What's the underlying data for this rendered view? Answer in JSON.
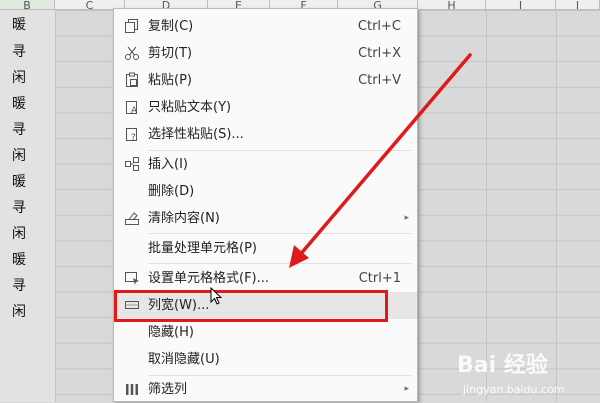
{
  "columns": [
    "B",
    "C",
    "D",
    "E",
    "F",
    "G",
    "H",
    "I",
    "J"
  ],
  "b_cells": [
    "暖",
    "寻",
    "闲",
    "暖",
    "寻",
    "闲",
    "暖",
    "寻",
    "闲",
    "暖",
    "寻",
    "闲"
  ],
  "menu": {
    "items": [
      {
        "label": "复制(C)",
        "shortcut": "Ctrl+C",
        "icon": "copy-icon"
      },
      {
        "label": "剪切(T)",
        "shortcut": "Ctrl+X",
        "icon": "scissors-icon"
      },
      {
        "label": "粘贴(P)",
        "shortcut": "Ctrl+V",
        "icon": "paste-icon"
      },
      {
        "label": "只粘贴文本(Y)",
        "shortcut": "",
        "icon": "paste-text-icon"
      },
      {
        "label": "选择性粘贴(S)...",
        "shortcut": "",
        "icon": "paste-special-icon"
      },
      {
        "label": "插入(I)",
        "shortcut": "",
        "icon": "insert-icon"
      },
      {
        "label": "删除(D)",
        "shortcut": "",
        "icon": ""
      },
      {
        "label": "清除内容(N)",
        "shortcut": "",
        "icon": "eraser-icon",
        "submenu": true
      },
      {
        "label": "批量处理单元格(P)",
        "shortcut": "",
        "icon": ""
      },
      {
        "label": "设置单元格格式(F)...",
        "shortcut": "Ctrl+1",
        "icon": "format-cells-icon"
      },
      {
        "label": "列宽(W)...",
        "shortcut": "",
        "icon": "column-width-icon"
      },
      {
        "label": "隐藏(H)",
        "shortcut": "",
        "icon": ""
      },
      {
        "label": "取消隐藏(U)",
        "shortcut": "",
        "icon": ""
      },
      {
        "label": "筛选列",
        "shortcut": "",
        "icon": "filter-column-icon",
        "submenu": true
      }
    ],
    "submenu_arrow": "▸"
  },
  "highlighted_item": "列宽(W)...",
  "annotation_color": "#e0191c",
  "watermark": {
    "brand": "Bai 经验",
    "url": "jingyan.baidu.com"
  }
}
